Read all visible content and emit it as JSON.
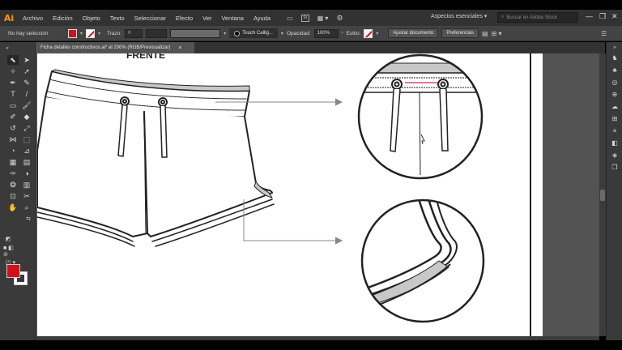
{
  "app": {
    "logo": "Ai",
    "menu": [
      "Archivo",
      "Edición",
      "Objeto",
      "Texto",
      "Seleccionar",
      "Efecto",
      "Ver",
      "Ventana",
      "Ayuda"
    ],
    "workspace": "Aspectos esenciales",
    "search_placeholder": "Buscar en Adobe Stock"
  },
  "control_bar": {
    "selection": "No hay selección",
    "stroke_label": "Trazo:",
    "brush_name": "Touch Callig...",
    "opacity_label": "Opacidad:",
    "opacity_value": "100%",
    "style_label": "Estilo:",
    "ajustar_button": "Ajustar documento",
    "preferencias_button": "Preferencias"
  },
  "document": {
    "tab_title": "Ficha detalles constructivos.ai* al 200% (RGB/Previsualizar)",
    "tab_close": "×"
  },
  "artwork": {
    "front_label": "FRENTE"
  },
  "colors": {
    "fill": "#d0111b",
    "accent": "#ff9a00",
    "drawcord_highlight": "#e0457b"
  },
  "icons": {
    "tools": [
      "selection-tool",
      "direct-selection-tool",
      "magic-wand-tool",
      "lasso-tool",
      "pen-tool",
      "curvature-tool",
      "type-tool",
      "line-tool",
      "rectangle-tool",
      "paintbrush-tool",
      "shaper-tool",
      "eraser-tool",
      "rotate-tool",
      "scale-tool",
      "width-tool",
      "free-transform-tool",
      "shape-builder-tool",
      "perspective-grid-tool",
      "mesh-tool",
      "gradient-tool",
      "eyedropper-tool",
      "blend-tool",
      "symbol-sprayer-tool",
      "column-graph-tool",
      "artboard-tool",
      "slice-tool",
      "hand-tool",
      "zoom-tool"
    ]
  }
}
